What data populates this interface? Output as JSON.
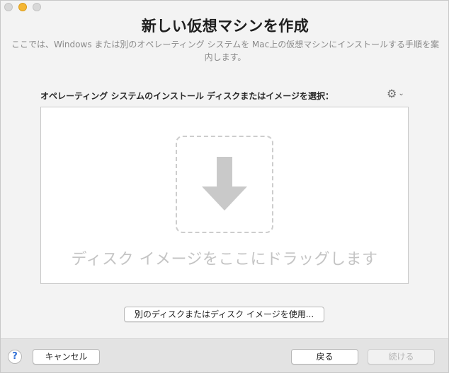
{
  "window": {
    "title": "新しい仮想マシンを作成",
    "subtitle": "ここでは、Windows または別のオペレーティング システムを Mac上の仮想マシンにインストールする手順を案内します。"
  },
  "selector": {
    "label": "オペレーティング システムのインストール ディスクまたはイメージを選択：",
    "gear_icon": "gear-icon",
    "chevron_icon": "chevron-down-icon"
  },
  "dropzone": {
    "icon": "arrow-down-icon",
    "text": "ディスク イメージをここにドラッグします"
  },
  "buttons": {
    "other_disk": "別のディスクまたはディスク イメージを使用...",
    "help": "?",
    "cancel": "キャンセル",
    "back": "戻る",
    "continue": "続ける"
  },
  "colors": {
    "accent_min": "#f5b735",
    "help_blue": "#2f6fd6",
    "placeholder_gray": "#c4c4c4"
  }
}
